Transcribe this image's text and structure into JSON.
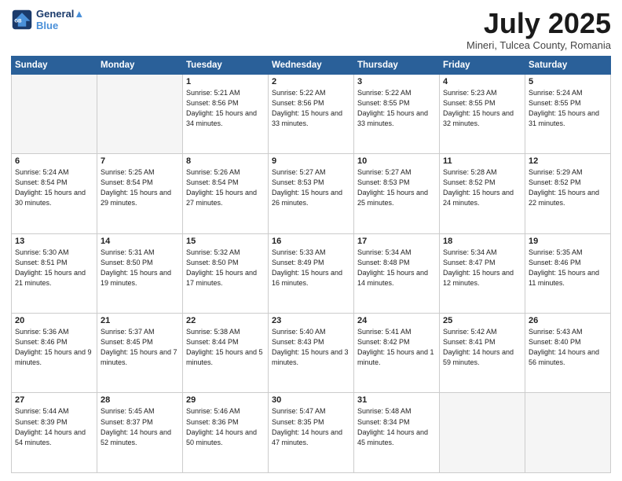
{
  "header": {
    "logo_line1": "General",
    "logo_line2": "Blue",
    "month_title": "July 2025",
    "location": "Mineri, Tulcea County, Romania"
  },
  "days_of_week": [
    "Sunday",
    "Monday",
    "Tuesday",
    "Wednesday",
    "Thursday",
    "Friday",
    "Saturday"
  ],
  "weeks": [
    [
      {
        "day": "",
        "empty": true
      },
      {
        "day": "",
        "empty": true
      },
      {
        "day": "1",
        "sunrise": "5:21 AM",
        "sunset": "8:56 PM",
        "daylight": "15 hours and 34 minutes."
      },
      {
        "day": "2",
        "sunrise": "5:22 AM",
        "sunset": "8:56 PM",
        "daylight": "15 hours and 33 minutes."
      },
      {
        "day": "3",
        "sunrise": "5:22 AM",
        "sunset": "8:55 PM",
        "daylight": "15 hours and 33 minutes."
      },
      {
        "day": "4",
        "sunrise": "5:23 AM",
        "sunset": "8:55 PM",
        "daylight": "15 hours and 32 minutes."
      },
      {
        "day": "5",
        "sunrise": "5:24 AM",
        "sunset": "8:55 PM",
        "daylight": "15 hours and 31 minutes."
      }
    ],
    [
      {
        "day": "6",
        "sunrise": "5:24 AM",
        "sunset": "8:54 PM",
        "daylight": "15 hours and 30 minutes."
      },
      {
        "day": "7",
        "sunrise": "5:25 AM",
        "sunset": "8:54 PM",
        "daylight": "15 hours and 29 minutes."
      },
      {
        "day": "8",
        "sunrise": "5:26 AM",
        "sunset": "8:54 PM",
        "daylight": "15 hours and 27 minutes."
      },
      {
        "day": "9",
        "sunrise": "5:27 AM",
        "sunset": "8:53 PM",
        "daylight": "15 hours and 26 minutes."
      },
      {
        "day": "10",
        "sunrise": "5:27 AM",
        "sunset": "8:53 PM",
        "daylight": "15 hours and 25 minutes."
      },
      {
        "day": "11",
        "sunrise": "5:28 AM",
        "sunset": "8:52 PM",
        "daylight": "15 hours and 24 minutes."
      },
      {
        "day": "12",
        "sunrise": "5:29 AM",
        "sunset": "8:52 PM",
        "daylight": "15 hours and 22 minutes."
      }
    ],
    [
      {
        "day": "13",
        "sunrise": "5:30 AM",
        "sunset": "8:51 PM",
        "daylight": "15 hours and 21 minutes."
      },
      {
        "day": "14",
        "sunrise": "5:31 AM",
        "sunset": "8:50 PM",
        "daylight": "15 hours and 19 minutes."
      },
      {
        "day": "15",
        "sunrise": "5:32 AM",
        "sunset": "8:50 PM",
        "daylight": "15 hours and 17 minutes."
      },
      {
        "day": "16",
        "sunrise": "5:33 AM",
        "sunset": "8:49 PM",
        "daylight": "15 hours and 16 minutes."
      },
      {
        "day": "17",
        "sunrise": "5:34 AM",
        "sunset": "8:48 PM",
        "daylight": "15 hours and 14 minutes."
      },
      {
        "day": "18",
        "sunrise": "5:34 AM",
        "sunset": "8:47 PM",
        "daylight": "15 hours and 12 minutes."
      },
      {
        "day": "19",
        "sunrise": "5:35 AM",
        "sunset": "8:46 PM",
        "daylight": "15 hours and 11 minutes."
      }
    ],
    [
      {
        "day": "20",
        "sunrise": "5:36 AM",
        "sunset": "8:46 PM",
        "daylight": "15 hours and 9 minutes."
      },
      {
        "day": "21",
        "sunrise": "5:37 AM",
        "sunset": "8:45 PM",
        "daylight": "15 hours and 7 minutes."
      },
      {
        "day": "22",
        "sunrise": "5:38 AM",
        "sunset": "8:44 PM",
        "daylight": "15 hours and 5 minutes."
      },
      {
        "day": "23",
        "sunrise": "5:40 AM",
        "sunset": "8:43 PM",
        "daylight": "15 hours and 3 minutes."
      },
      {
        "day": "24",
        "sunrise": "5:41 AM",
        "sunset": "8:42 PM",
        "daylight": "15 hours and 1 minute."
      },
      {
        "day": "25",
        "sunrise": "5:42 AM",
        "sunset": "8:41 PM",
        "daylight": "14 hours and 59 minutes."
      },
      {
        "day": "26",
        "sunrise": "5:43 AM",
        "sunset": "8:40 PM",
        "daylight": "14 hours and 56 minutes."
      }
    ],
    [
      {
        "day": "27",
        "sunrise": "5:44 AM",
        "sunset": "8:39 PM",
        "daylight": "14 hours and 54 minutes."
      },
      {
        "day": "28",
        "sunrise": "5:45 AM",
        "sunset": "8:37 PM",
        "daylight": "14 hours and 52 minutes."
      },
      {
        "day": "29",
        "sunrise": "5:46 AM",
        "sunset": "8:36 PM",
        "daylight": "14 hours and 50 minutes."
      },
      {
        "day": "30",
        "sunrise": "5:47 AM",
        "sunset": "8:35 PM",
        "daylight": "14 hours and 47 minutes."
      },
      {
        "day": "31",
        "sunrise": "5:48 AM",
        "sunset": "8:34 PM",
        "daylight": "14 hours and 45 minutes."
      },
      {
        "day": "",
        "empty": true
      },
      {
        "day": "",
        "empty": true
      }
    ]
  ]
}
